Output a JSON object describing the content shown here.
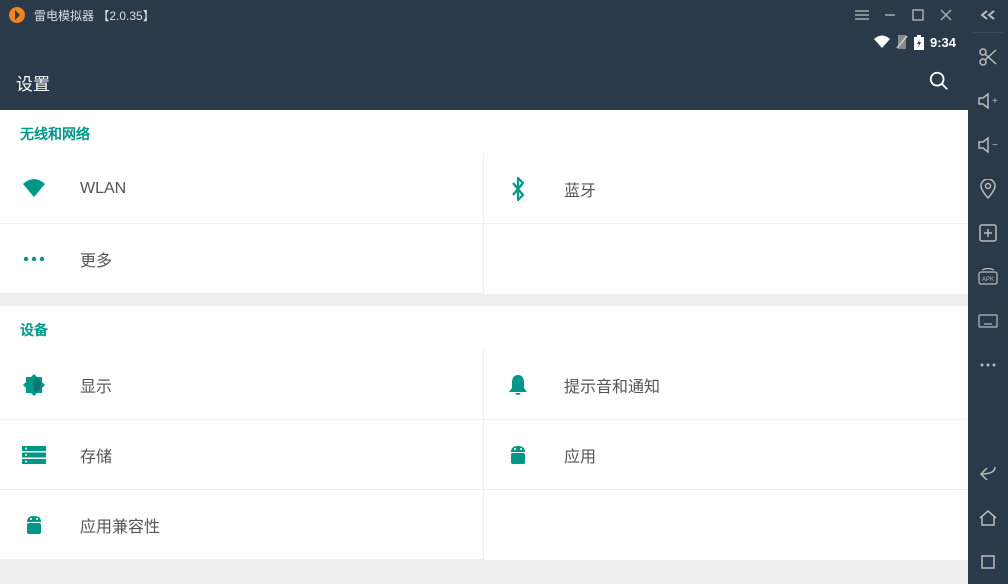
{
  "titlebar": {
    "title": "雷电模拟器 【2.0.35】"
  },
  "statusbar": {
    "time": "9:34"
  },
  "appbar": {
    "title": "设置"
  },
  "sections": [
    {
      "header": "无线和网络",
      "items": [
        {
          "icon": "wifi",
          "label": "WLAN"
        },
        {
          "icon": "bluetooth",
          "label": "蓝牙"
        },
        {
          "icon": "more",
          "label": "更多"
        }
      ]
    },
    {
      "header": "设备",
      "items": [
        {
          "icon": "brightness",
          "label": "显示"
        },
        {
          "icon": "bell",
          "label": "提示音和通知"
        },
        {
          "icon": "storage",
          "label": "存储"
        },
        {
          "icon": "android",
          "label": "应用"
        },
        {
          "icon": "android",
          "label": "应用兼容性"
        }
      ]
    }
  ],
  "sidebar_icons": [
    "collapse",
    "scissors",
    "vol-up",
    "vol-down",
    "location",
    "new-tab",
    "apk",
    "keyboard",
    "more-vert",
    "back",
    "home",
    "recent"
  ]
}
